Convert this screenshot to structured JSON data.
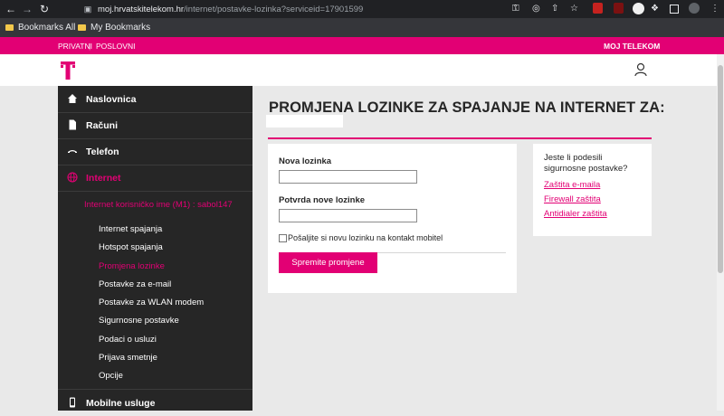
{
  "browser": {
    "back": "←",
    "forward": "→",
    "reload": "↻",
    "url_host": "moj.hrvatskitelekom.hr",
    "url_path": "/internet/postavke-lozinka?serviceid=17901599",
    "bookmarks": [
      "Bookmarks All",
      "My Bookmarks"
    ]
  },
  "topbar": {
    "privatni": "PRIVATNI",
    "poslovni": "POSLOVNI",
    "moj": "MOJ TELEKOM"
  },
  "sidebar": {
    "main": [
      {
        "label": "Naslovnica",
        "icon": "home-icon"
      },
      {
        "label": "Računi",
        "icon": "document-icon"
      },
      {
        "label": "Telefon",
        "icon": "phone-icon"
      },
      {
        "label": "Internet",
        "icon": "globe-icon"
      },
      {
        "label": "Mobilne usluge",
        "icon": "mobile-icon"
      }
    ],
    "account": "Internet korisničko ime (M1) : sabol147",
    "sub": [
      "Internet spajanja",
      "Hotspot spajanja",
      "Promjena lozinke",
      "Postavke za e-mail",
      "Postavke za WLAN modem",
      "Sigurnosne postavke",
      "Podaci o usluzi",
      "Prijava smetnje",
      "Opcije"
    ]
  },
  "main": {
    "title": "PROMJENA LOZINKE ZA SPAJANJE NA INTERNET ZA:",
    "new_password_label": "Nova lozinka",
    "new_password_value": "",
    "confirm_label": "Potvrda nove lozinke",
    "confirm_value": "",
    "send_checkbox_label": "Pošaljite si novu lozinku na kontakt mobitel",
    "save_button": "Spremite promjene"
  },
  "aside": {
    "question": "Jeste li podesili sigurnosne postavke?",
    "links": [
      "Zaštita e-maila",
      "Firewall zaštita",
      "Antidialer zaštita"
    ]
  },
  "colors": {
    "brand": "#e20074",
    "sidebar_bg": "#262626"
  }
}
